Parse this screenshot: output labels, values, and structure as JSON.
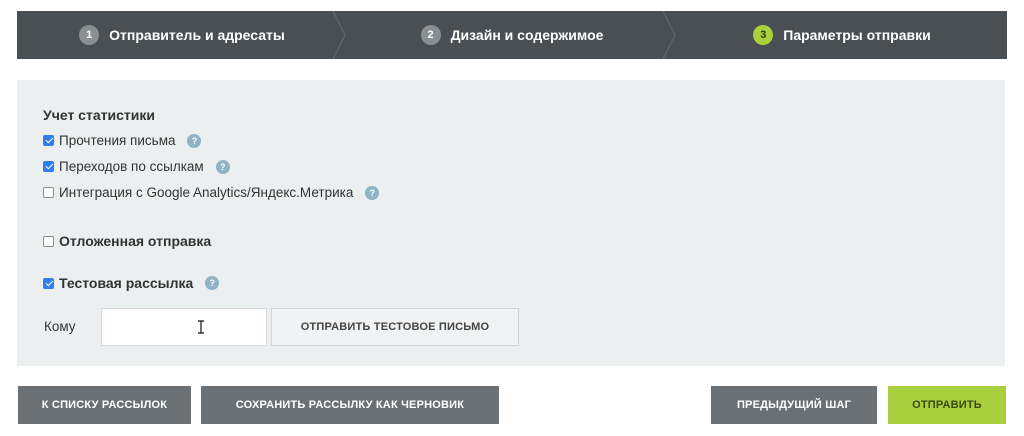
{
  "stepper": {
    "steps": [
      {
        "number": "1",
        "label": "Отправитель и адресаты",
        "active": false
      },
      {
        "number": "2",
        "label": "Дизайн и содержимое",
        "active": false
      },
      {
        "number": "3",
        "label": "Параметры отправки",
        "active": true
      }
    ]
  },
  "stats": {
    "title": "Учет статистики",
    "items": [
      {
        "label": "Прочтения письма",
        "checked": true,
        "help": "?"
      },
      {
        "label": "Переходов по ссылкам",
        "checked": true,
        "help": "?"
      },
      {
        "label": "Интеграция с Google Analytics/Яндекс.Метрика",
        "checked": false,
        "help": "?"
      }
    ]
  },
  "delayed": {
    "label": "Отложенная отправка",
    "checked": false
  },
  "test": {
    "label": "Тестовая рассылка",
    "checked": true,
    "help": "?",
    "to_label": "Кому",
    "to_value": "",
    "send_button": "ОТПРАВИТЬ ТЕСТОВОЕ ПИСЬМО"
  },
  "footer": {
    "back_to_list": "К СПИСКУ РАССЫЛОК",
    "save_draft": "СОХРАНИТЬ РАССЫЛКУ КАК ЧЕРНОВИК",
    "prev_step": "ПРЕДЫДУЩИЙ ШАГ",
    "send": "ОТПРАВИТЬ"
  },
  "colors": {
    "stepper_bg": "#4a4f55",
    "active_step": "#a9d13a",
    "panel_bg": "#ebeff0",
    "checkbox": "#2d7ff0",
    "send_button": "#a8cf3e"
  }
}
